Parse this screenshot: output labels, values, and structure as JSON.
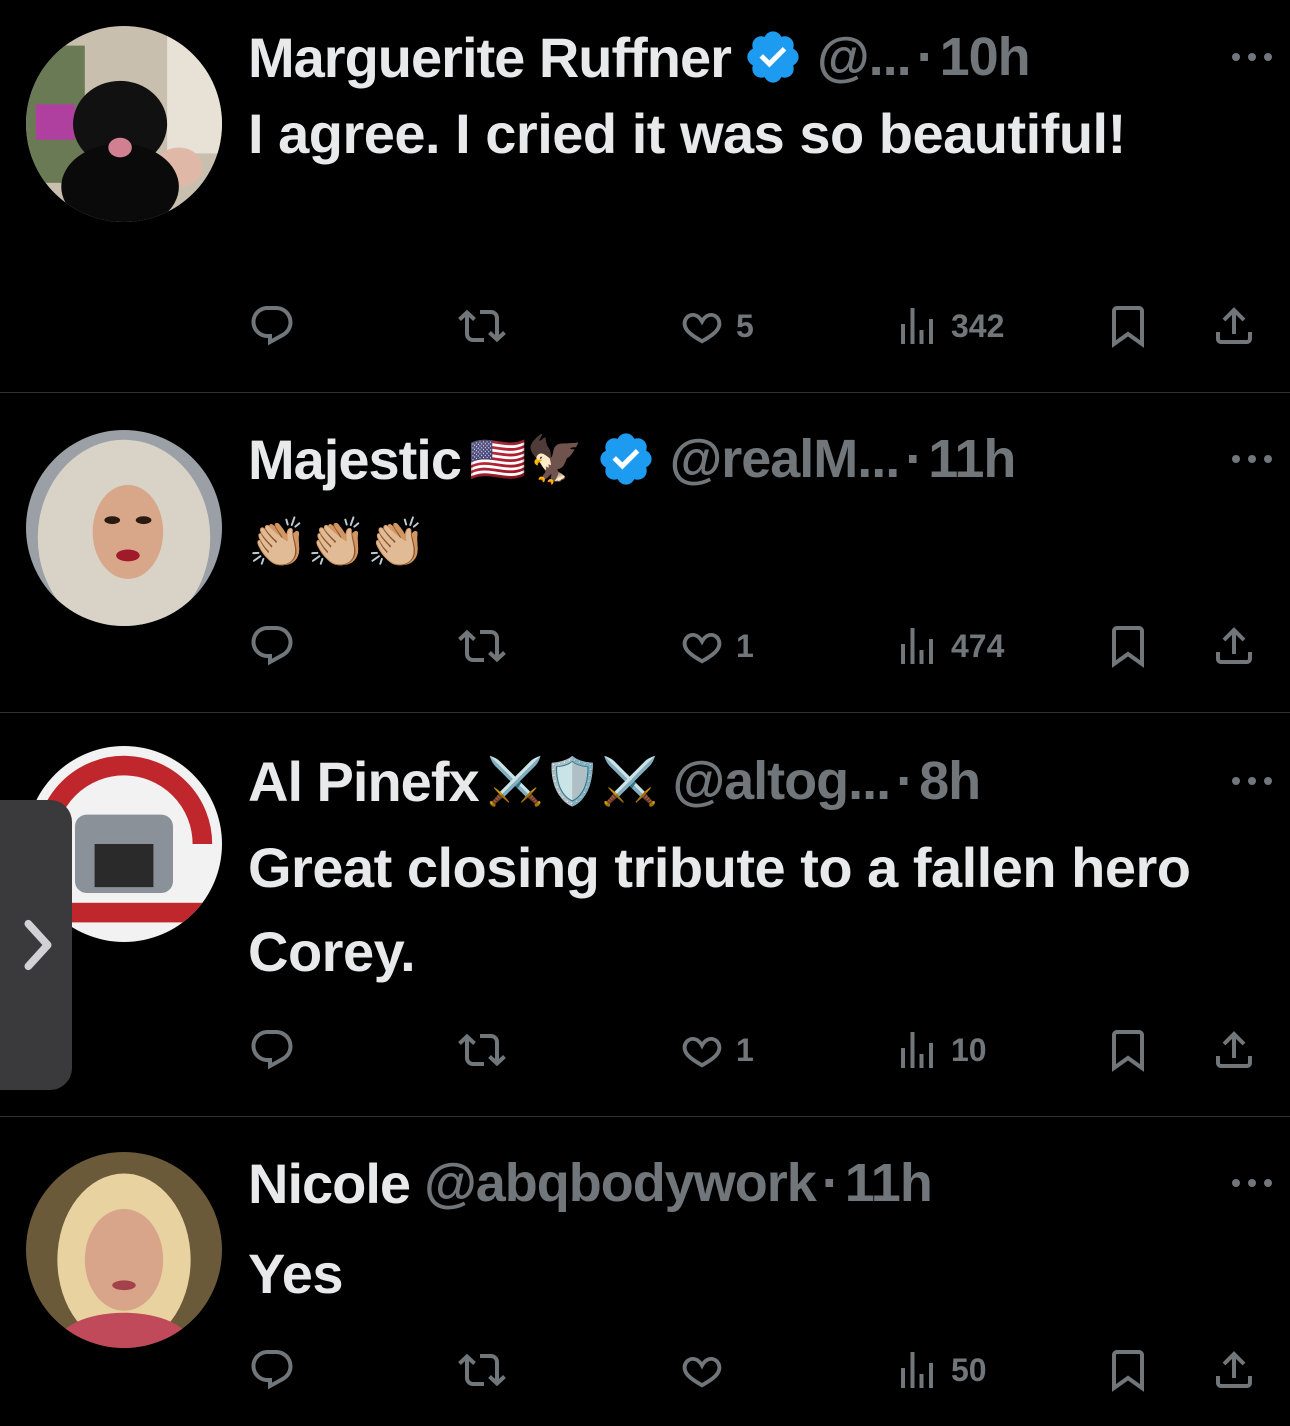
{
  "tweets": [
    {
      "name": "Marguerite Ruffner",
      "name_emoji": "",
      "handle": "@...",
      "time": "10h",
      "verified": true,
      "text": "I agree. I cried it was so beautiful!",
      "likes": "5",
      "views": "342"
    },
    {
      "name": "Majestic",
      "name_emoji": "🇺🇸🦅",
      "handle": "@realM...",
      "time": "11h",
      "verified": true,
      "text": "👏🏼👏🏼👏🏼",
      "likes": "1",
      "views": "474"
    },
    {
      "name": "Al Pinefx",
      "name_emoji": "⚔️🛡️⚔️",
      "handle": "@altog...",
      "time": "8h",
      "verified": false,
      "text": "Great closing tribute to a fallen hero Corey.",
      "likes": "1",
      "views": "10"
    },
    {
      "name": "Nicole",
      "name_emoji": "",
      "handle": "@abqbodywork",
      "time": "11h",
      "verified": false,
      "text": "Yes",
      "likes": "",
      "views": "50"
    }
  ],
  "separator": "·",
  "side_tab_icon": "chevron-right-icon",
  "colors": {
    "background": "#000000",
    "text": "#e7e9ea",
    "muted": "#71767b",
    "verified": "#1d9bf0"
  }
}
